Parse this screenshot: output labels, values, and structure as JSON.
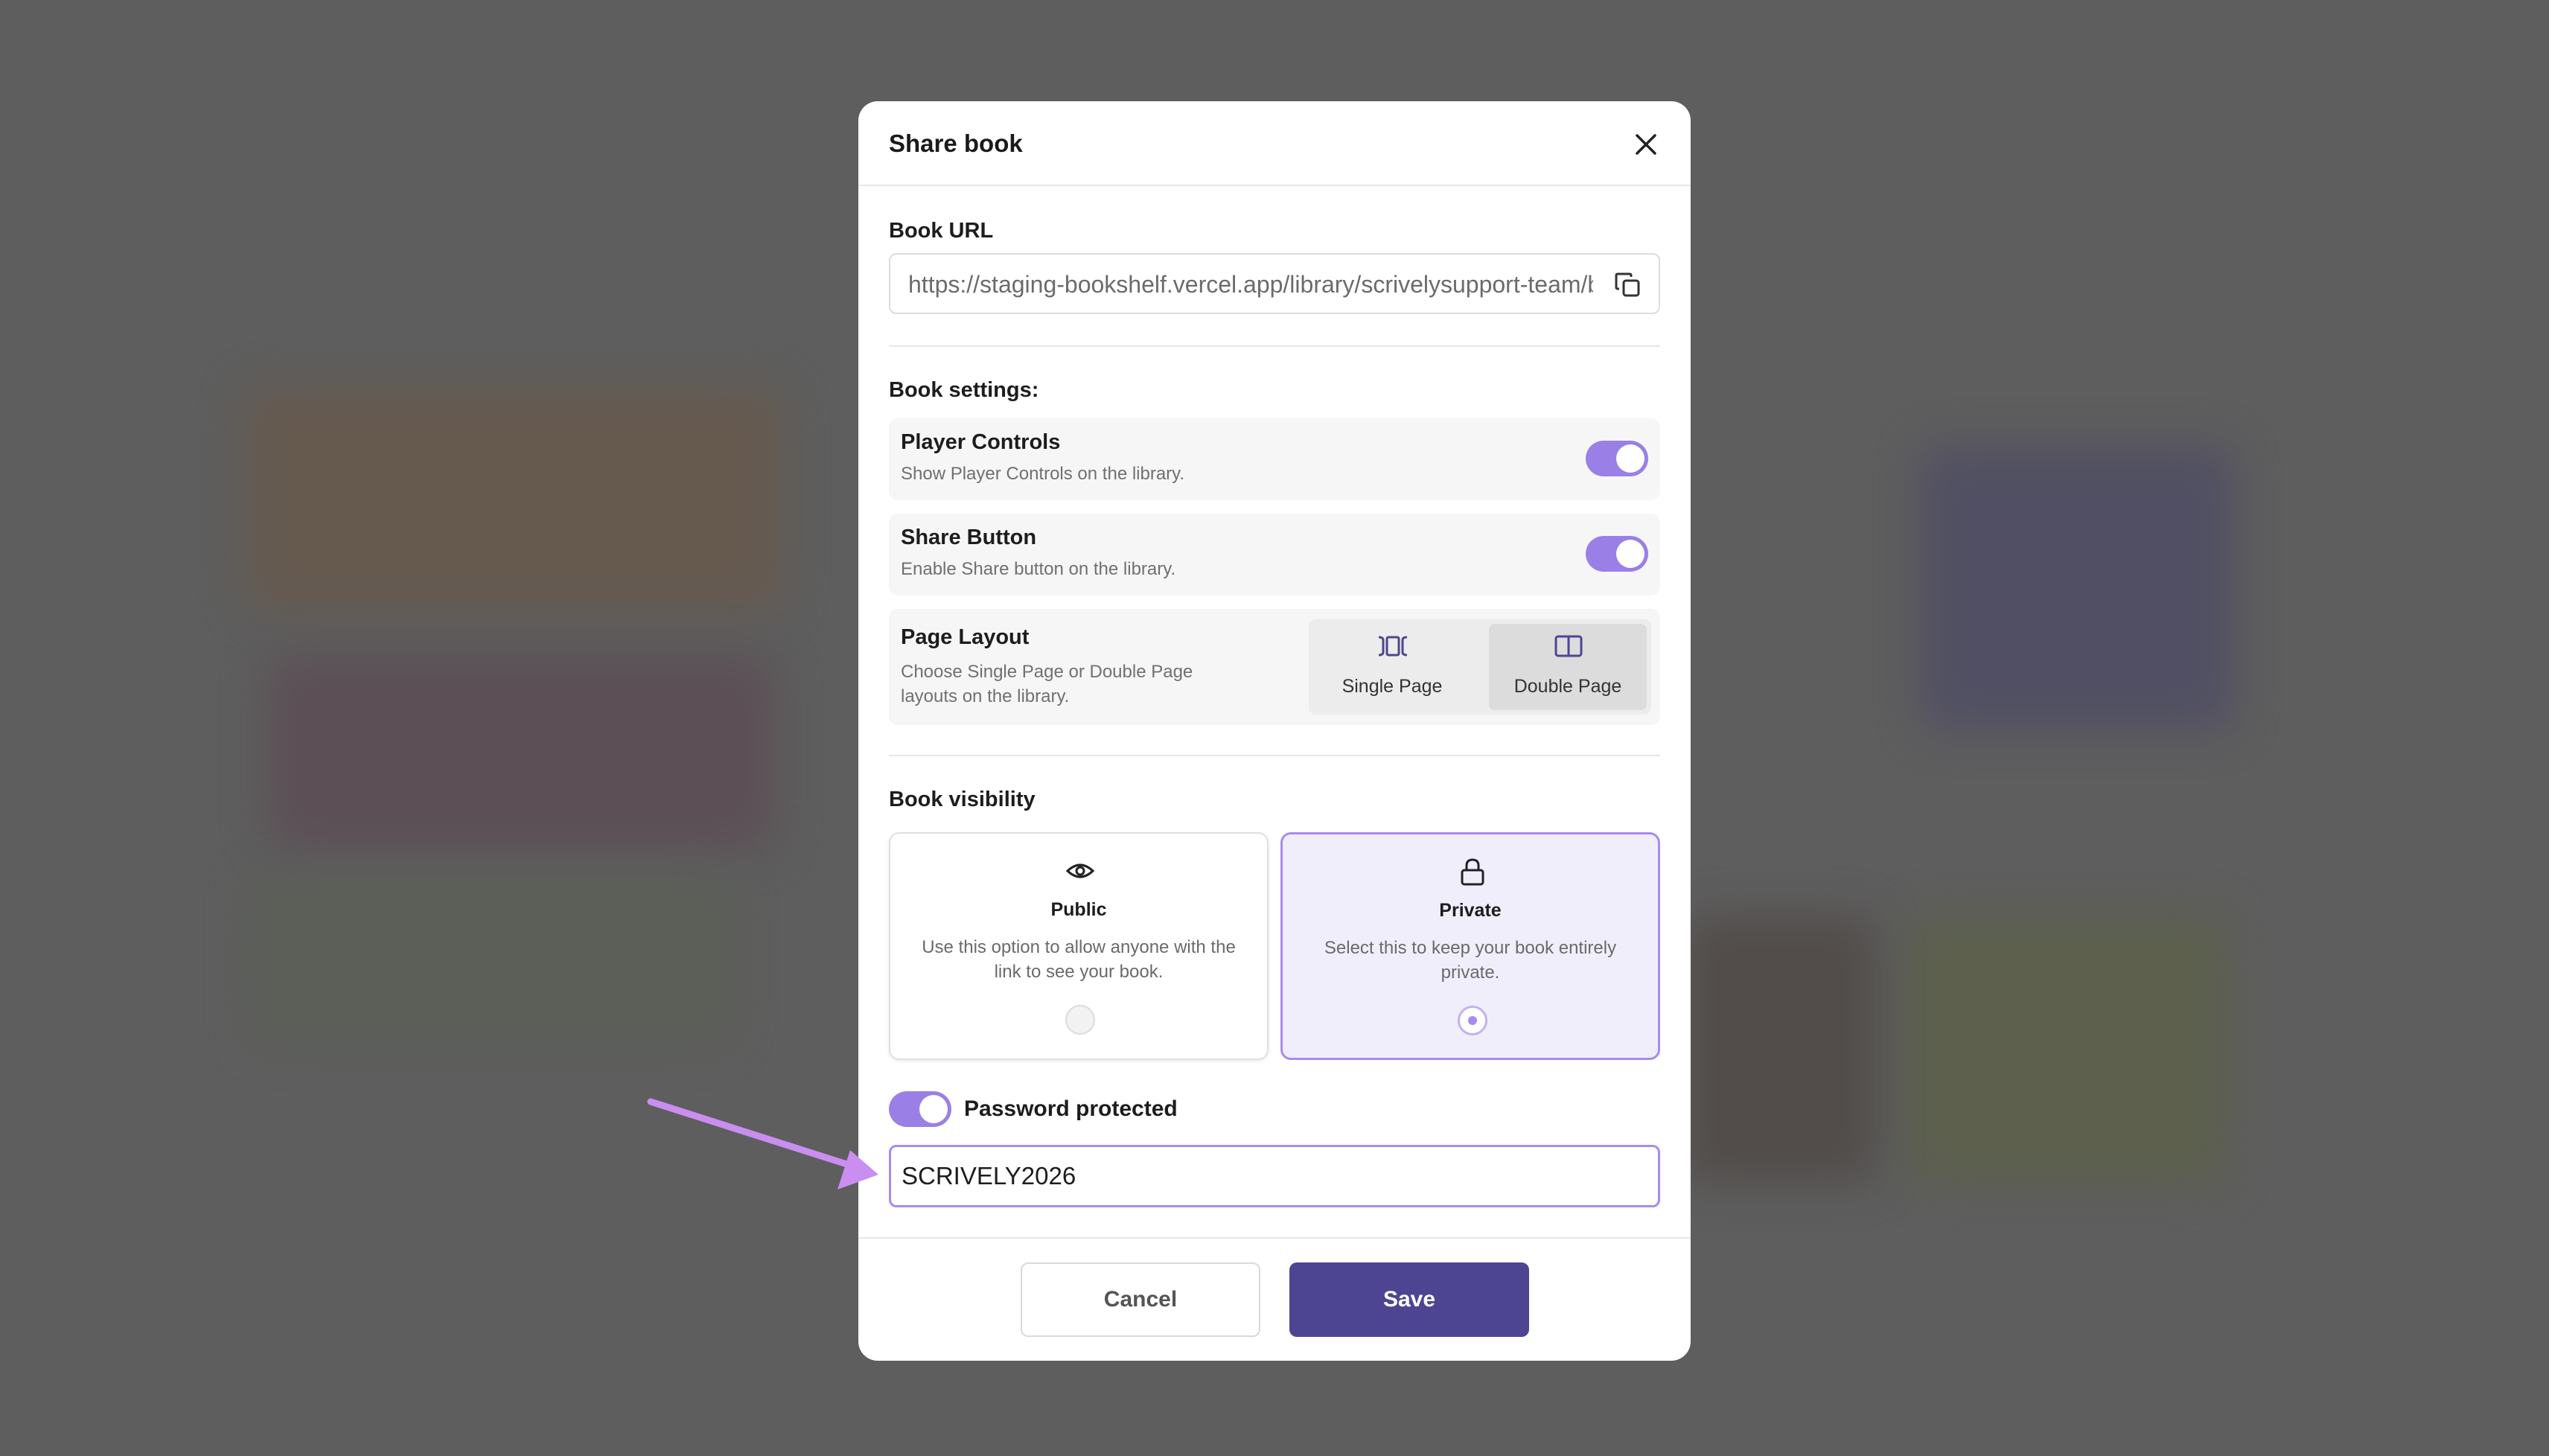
{
  "modal": {
    "title": "Share book",
    "book_url_label": "Book URL",
    "book_url_value": "https://staging-bookshelf.vercel.app/library/scrivelysupport-team/b",
    "book_settings_label": "Book settings:",
    "settings": [
      {
        "title": "Player Controls",
        "desc": "Show Player Controls on the library.",
        "enabled": true
      },
      {
        "title": "Share Button",
        "desc": "Enable Share button on the library.",
        "enabled": true
      },
      {
        "title": "Page Layout",
        "desc": "Choose Single Page or Double Page layouts on the library."
      }
    ],
    "layout_options": [
      {
        "label": "Single Page",
        "selected": false
      },
      {
        "label": "Double Page",
        "selected": true
      }
    ],
    "visibility_label": "Book visibility",
    "visibility": {
      "public": {
        "title": "Public",
        "desc": "Use this option to allow anyone with the link to see your book.",
        "selected": false
      },
      "private": {
        "title": "Private",
        "desc": "Select this to keep your book entirely private.",
        "selected": true
      }
    },
    "password_protected_label": "Password protected",
    "password_protected": true,
    "password_value": "SCRIVELY2026",
    "cancel_label": "Cancel",
    "save_label": "Save"
  },
  "colors": {
    "accent": "#a78bf0",
    "toggle": "#9a7fe6",
    "primary_button": "#4e4592",
    "overlay": "#707070"
  }
}
